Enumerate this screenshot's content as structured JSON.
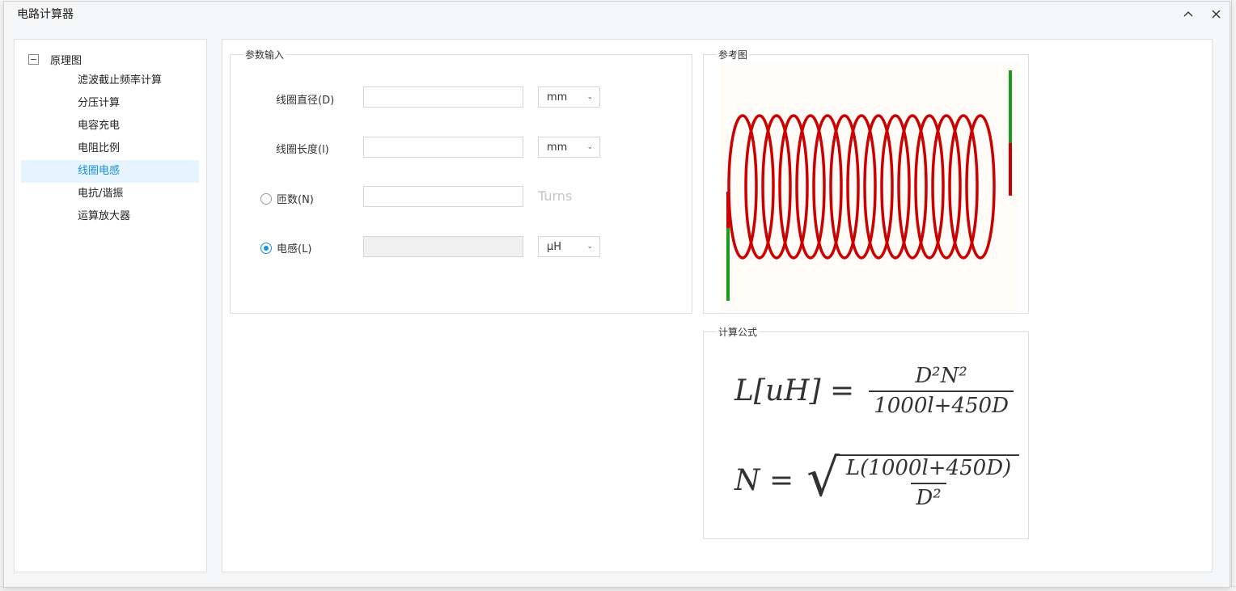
{
  "window": {
    "title": "电路计算器"
  },
  "tree": {
    "root_label": "原理图",
    "items": [
      {
        "label": "滤波截止频率计算"
      },
      {
        "label": "分压计算"
      },
      {
        "label": "电容充电"
      },
      {
        "label": "电阻比例"
      },
      {
        "label": "线圈电感"
      },
      {
        "label": "电抗/谐振"
      },
      {
        "label": "运算放大器"
      }
    ],
    "selected": "线圈电感"
  },
  "input_group": {
    "legend": "参数输入",
    "diameter": {
      "label": "线圈直径(D)",
      "value": "",
      "unit": "mm"
    },
    "length": {
      "label": "线圈长度(l)",
      "value": "",
      "unit": "mm"
    },
    "turns": {
      "label": "匝数(N)",
      "value": "",
      "unit_text": "Turns",
      "selected": false
    },
    "inductance": {
      "label": "电感(L)",
      "value": "",
      "unit": "μH",
      "selected": true
    }
  },
  "ref_group": {
    "legend": "参考图",
    "image": "coil-diagram"
  },
  "formula_group": {
    "legend": "计算公式",
    "f1_lhs": "L[uH] =",
    "f1_num": "D²N²",
    "f1_den": "1000l+450D",
    "f2_lhs": "N =",
    "f2_num": "L(1000l+450D)",
    "f2_den": "D²"
  },
  "colors": {
    "accent": "#1a8fdc",
    "coil": "#cc0000",
    "lead": "#1a9a1a"
  },
  "icons": {
    "minimize": "chevron-up-icon",
    "close": "close-icon"
  }
}
